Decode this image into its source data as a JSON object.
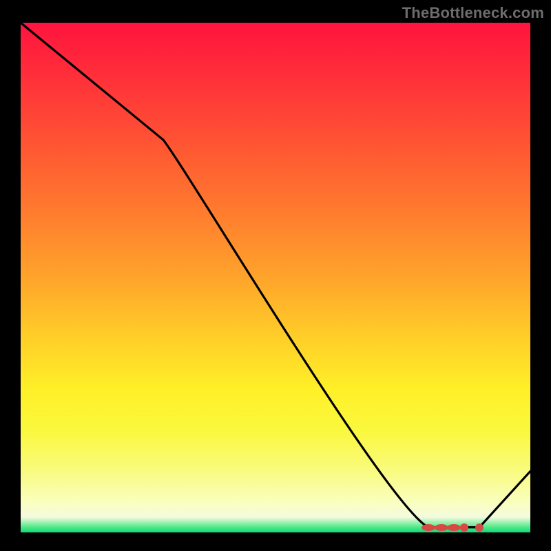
{
  "watermark": "TheBottleneck.com",
  "chart_data": {
    "type": "line",
    "title": "",
    "xlabel": "",
    "ylabel": "",
    "xlim": [
      0,
      100
    ],
    "ylim": [
      0,
      100
    ],
    "grid": false,
    "legend": false,
    "series": [
      {
        "name": "bottleneck-curve",
        "x": [
          0,
          28,
          80,
          90,
          100
        ],
        "y": [
          100,
          77,
          1,
          1,
          12
        ],
        "annotations": [
          {
            "x": 80,
            "y": 1,
            "shape": "ellipse"
          },
          {
            "x": 82.5,
            "y": 1,
            "shape": "ellipse"
          },
          {
            "x": 85,
            "y": 1,
            "shape": "ellipse"
          },
          {
            "x": 87,
            "y": 1,
            "shape": "round"
          },
          {
            "x": 90,
            "y": 1,
            "shape": "round"
          }
        ]
      }
    ],
    "background_gradient": {
      "top": "#ff143e",
      "mid": "#ffe928",
      "bottom": "#09de7b"
    }
  }
}
